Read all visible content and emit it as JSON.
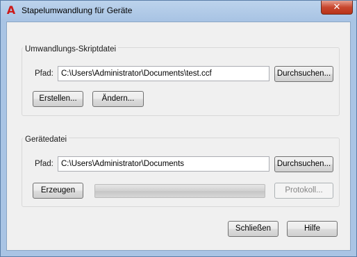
{
  "window": {
    "title": "Stapelumwandlung für Geräte",
    "app_icon_glyph": "A",
    "close_glyph": "✕"
  },
  "script_group": {
    "title": "Umwandlungs-Skriptdatei",
    "path_label": "Pfad:",
    "path_value": "C:\\Users\\Administrator\\Documents\\test.ccf",
    "browse_label": "Durchsuchen...",
    "create_label": "Erstellen...",
    "modify_label": "Ändern..."
  },
  "device_group": {
    "title": "Gerätedatei",
    "path_label": "Pfad:",
    "path_value": "C:\\Users\\Administrator\\Documents",
    "browse_label": "Durchsuchen...",
    "generate_label": "Erzeugen",
    "protocol_label": "Protokoll...",
    "progress": 0
  },
  "footer": {
    "close_label": "Schließen",
    "help_label": "Hilfe"
  },
  "colors": {
    "titlebar": "#a9c4e4",
    "close": "#c8462e",
    "app_icon": "#cc1a1a"
  }
}
